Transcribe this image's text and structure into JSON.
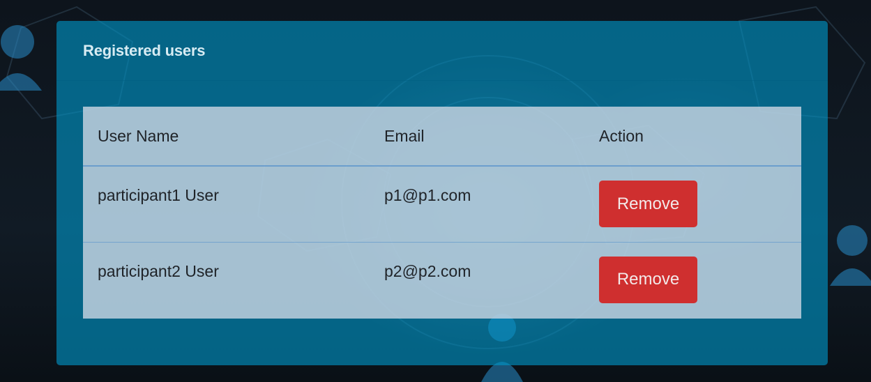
{
  "panel": {
    "title": "Registered users"
  },
  "table": {
    "headers": [
      "User Name",
      "Email",
      "Action"
    ],
    "rows": [
      {
        "user_name": "participant1 User",
        "email": "p1@p1.com",
        "action_label": "Remove"
      },
      {
        "user_name": "participant2 User",
        "email": "p2@p2.com",
        "action_label": "Remove"
      }
    ]
  },
  "colors": {
    "panel": "#0096c8",
    "remove_button": "#cf2f2f",
    "table_background": "#cdd7e4"
  },
  "icons": {
    "background_people": "user-silhouette-icon"
  }
}
